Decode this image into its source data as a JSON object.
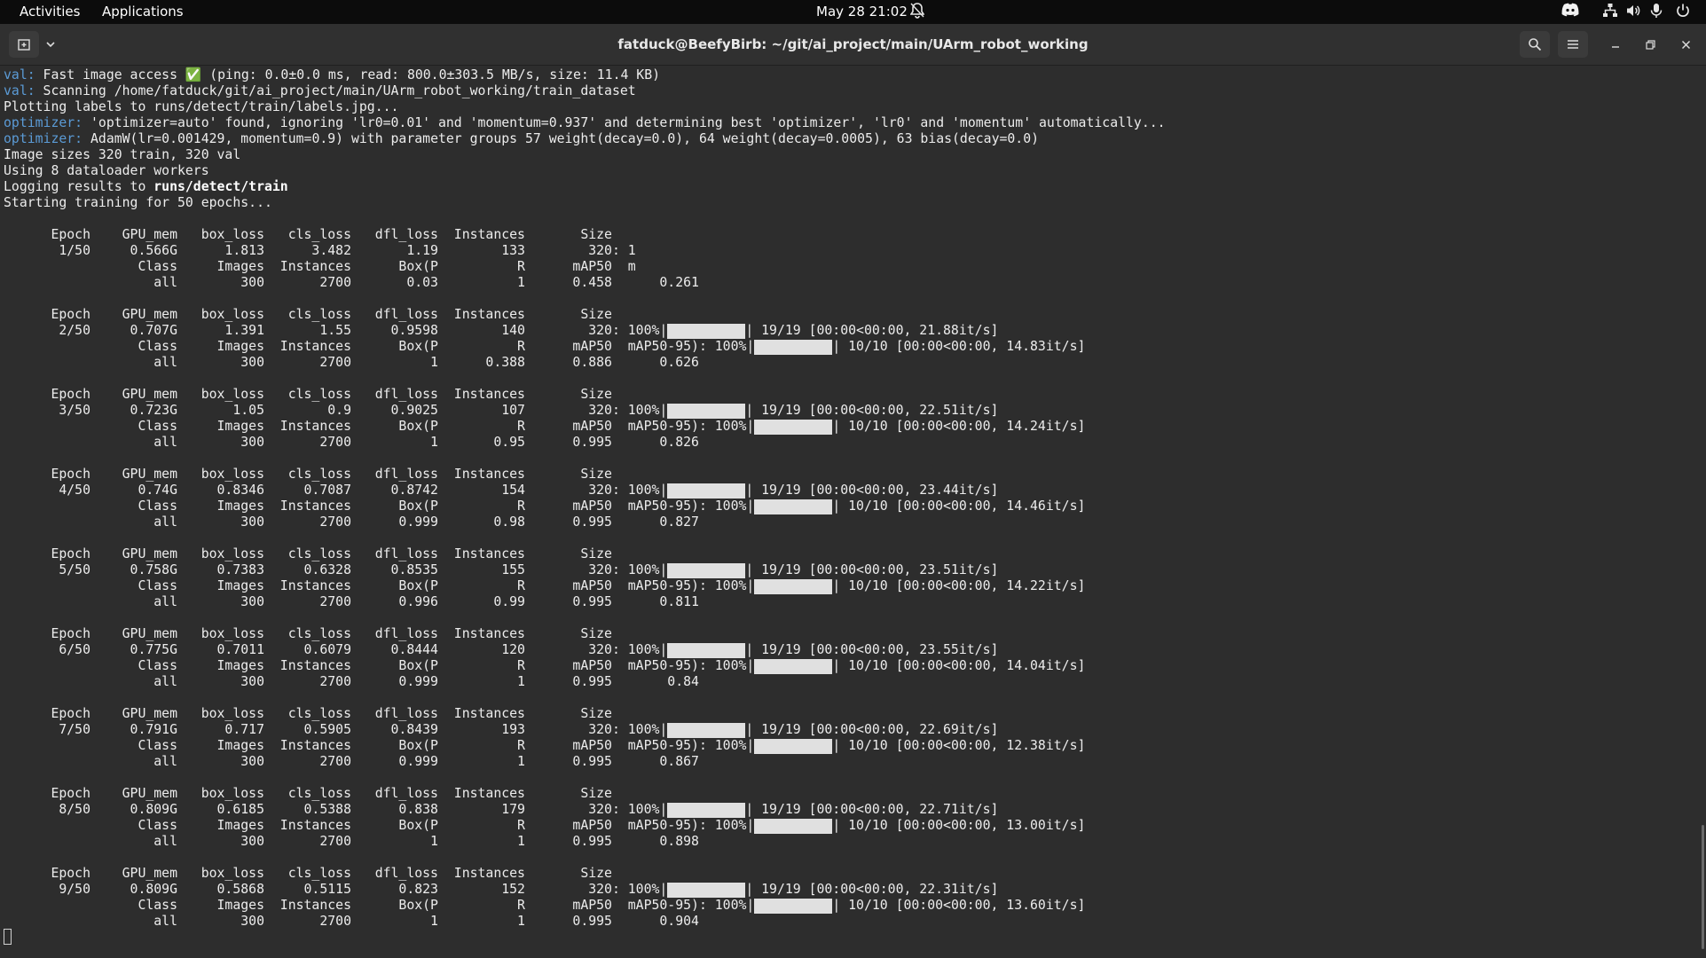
{
  "topbar": {
    "activities": "Activities",
    "applications": "Applications",
    "datetime": "May 28  21:02",
    "icons": [
      "bell-icon",
      "discord-icon",
      "network-icon",
      "volume-icon",
      "mic-icon",
      "power-icon"
    ]
  },
  "window": {
    "title": "fatduck@BeefyBirb: ~/git/ai_project/main/UArm_robot_working",
    "buttons": [
      "new-tab-icon",
      "chevron-down-icon",
      "search-icon",
      "hamburger-menu-icon",
      "minimize-icon",
      "maximize-icon",
      "close-icon"
    ]
  },
  "terminal": {
    "lines": [
      [
        {
          "t": "val:",
          "c": "hl"
        },
        {
          "t": " Fast image access ✅ (ping: 0.0±0.0 ms, read: 800.0±303.5 MB/s, size: 11.4 KB)"
        }
      ],
      [
        {
          "t": "val:",
          "c": "hl"
        },
        {
          "t": " Scanning /home/fatduck/git/ai_project/main/UArm_robot_working/train_dataset"
        }
      ],
      [
        {
          "t": "Plotting labels to runs/detect/train/labels.jpg..."
        }
      ],
      [
        {
          "t": "optimizer:",
          "c": "hl"
        },
        {
          "t": " 'optimizer=auto' found, ignoring 'lr0=0.01' and 'momentum=0.937' and determining best 'optimizer', 'lr0' and 'momentum' automatically..."
        }
      ],
      [
        {
          "t": "optimizer:",
          "c": "hl"
        },
        {
          "t": " AdamW(lr=0.001429, momentum=0.9) with parameter groups 57 weight(decay=0.0), 64 weight(decay=0.0005), 63 bias(decay=0.0)"
        }
      ],
      [
        {
          "t": "Image sizes 320 train, 320 val"
        }
      ],
      [
        {
          "t": "Using 8 dataloader workers"
        }
      ],
      [
        {
          "t": "Logging results to "
        },
        {
          "t": "runs/detect/train",
          "c": "bold"
        }
      ],
      [
        {
          "t": "Starting training for 50 epochs..."
        }
      ],
      [
        {
          "t": ""
        }
      ],
      [
        {
          "t": "      Epoch    GPU_mem   box_loss   cls_loss   dfl_loss  Instances       Size"
        }
      ],
      [
        {
          "t": "       1/50     0.566G      1.813      3.482       1.19        133        320: 1"
        }
      ],
      [
        {
          "t": "                 Class     Images  Instances      Box(P          R      mAP50  m"
        }
      ],
      [
        {
          "t": "                   all        300       2700       0.03          1      0.458      0.261"
        }
      ],
      [
        {
          "t": ""
        }
      ],
      [
        {
          "t": "      Epoch    GPU_mem   box_loss   cls_loss   dfl_loss  Instances       Size"
        }
      ],
      [
        {
          "t": "       2/50     0.707G      1.391       1.55     0.9598        140        320: 100%|"
        },
        {
          "bar": true
        },
        {
          "t": "| 19/19 [00:00<00:00, 21.88it/s]"
        }
      ],
      [
        {
          "t": "                 Class     Images  Instances      Box(P          R      mAP50  mAP50-95): 100%|"
        },
        {
          "bar": true
        },
        {
          "t": "| 10/10 [00:00<00:00, 14.83it/s]"
        }
      ],
      [
        {
          "t": "                   all        300       2700          1      0.388      0.886      0.626"
        }
      ],
      [
        {
          "t": ""
        }
      ],
      [
        {
          "t": "      Epoch    GPU_mem   box_loss   cls_loss   dfl_loss  Instances       Size"
        }
      ],
      [
        {
          "t": "       3/50     0.723G       1.05        0.9     0.9025        107        320: 100%|"
        },
        {
          "bar": true
        },
        {
          "t": "| 19/19 [00:00<00:00, 22.51it/s]"
        }
      ],
      [
        {
          "t": "                 Class     Images  Instances      Box(P          R      mAP50  mAP50-95): 100%|"
        },
        {
          "bar": true
        },
        {
          "t": "| 10/10 [00:00<00:00, 14.24it/s]"
        }
      ],
      [
        {
          "t": "                   all        300       2700          1       0.95      0.995      0.826"
        }
      ],
      [
        {
          "t": ""
        }
      ],
      [
        {
          "t": "      Epoch    GPU_mem   box_loss   cls_loss   dfl_loss  Instances       Size"
        }
      ],
      [
        {
          "t": "       4/50      0.74G     0.8346     0.7087     0.8742        154        320: 100%|"
        },
        {
          "bar": true
        },
        {
          "t": "| 19/19 [00:00<00:00, 23.44it/s]"
        }
      ],
      [
        {
          "t": "                 Class     Images  Instances      Box(P          R      mAP50  mAP50-95): 100%|"
        },
        {
          "bar": true
        },
        {
          "t": "| 10/10 [00:00<00:00, 14.46it/s]"
        }
      ],
      [
        {
          "t": "                   all        300       2700      0.999       0.98      0.995      0.827"
        }
      ],
      [
        {
          "t": ""
        }
      ],
      [
        {
          "t": "      Epoch    GPU_mem   box_loss   cls_loss   dfl_loss  Instances       Size"
        }
      ],
      [
        {
          "t": "       5/50     0.758G     0.7383     0.6328     0.8535        155        320: 100%|"
        },
        {
          "bar": true
        },
        {
          "t": "| 19/19 [00:00<00:00, 23.51it/s]"
        }
      ],
      [
        {
          "t": "                 Class     Images  Instances      Box(P          R      mAP50  mAP50-95): 100%|"
        },
        {
          "bar": true
        },
        {
          "t": "| 10/10 [00:00<00:00, 14.22it/s]"
        }
      ],
      [
        {
          "t": "                   all        300       2700      0.996       0.99      0.995      0.811"
        }
      ],
      [
        {
          "t": ""
        }
      ],
      [
        {
          "t": "      Epoch    GPU_mem   box_loss   cls_loss   dfl_loss  Instances       Size"
        }
      ],
      [
        {
          "t": "       6/50     0.775G     0.7011     0.6079     0.8444        120        320: 100%|"
        },
        {
          "bar": true
        },
        {
          "t": "| 19/19 [00:00<00:00, 23.55it/s]"
        }
      ],
      [
        {
          "t": "                 Class     Images  Instances      Box(P          R      mAP50  mAP50-95): 100%|"
        },
        {
          "bar": true
        },
        {
          "t": "| 10/10 [00:00<00:00, 14.04it/s]"
        }
      ],
      [
        {
          "t": "                   all        300       2700      0.999          1      0.995       0.84"
        }
      ],
      [
        {
          "t": ""
        }
      ],
      [
        {
          "t": "      Epoch    GPU_mem   box_loss   cls_loss   dfl_loss  Instances       Size"
        }
      ],
      [
        {
          "t": "       7/50     0.791G      0.717     0.5905     0.8439        193        320: 100%|"
        },
        {
          "bar": true
        },
        {
          "t": "| 19/19 [00:00<00:00, 22.69it/s]"
        }
      ],
      [
        {
          "t": "                 Class     Images  Instances      Box(P          R      mAP50  mAP50-95): 100%|"
        },
        {
          "bar": true
        },
        {
          "t": "| 10/10 [00:00<00:00, 12.38it/s]"
        }
      ],
      [
        {
          "t": "                   all        300       2700      0.999          1      0.995      0.867"
        }
      ],
      [
        {
          "t": ""
        }
      ],
      [
        {
          "t": "      Epoch    GPU_mem   box_loss   cls_loss   dfl_loss  Instances       Size"
        }
      ],
      [
        {
          "t": "       8/50     0.809G     0.6185     0.5388      0.838        179        320: 100%|"
        },
        {
          "bar": true
        },
        {
          "t": "| 19/19 [00:00<00:00, 22.71it/s]"
        }
      ],
      [
        {
          "t": "                 Class     Images  Instances      Box(P          R      mAP50  mAP50-95): 100%|"
        },
        {
          "bar": true
        },
        {
          "t": "| 10/10 [00:00<00:00, 13.00it/s]"
        }
      ],
      [
        {
          "t": "                   all        300       2700          1          1      0.995      0.898"
        }
      ],
      [
        {
          "t": ""
        }
      ],
      [
        {
          "t": "      Epoch    GPU_mem   box_loss   cls_loss   dfl_loss  Instances       Size"
        }
      ],
      [
        {
          "t": "       9/50     0.809G     0.5868     0.5115      0.823        152        320: 100%|"
        },
        {
          "bar": true
        },
        {
          "t": "| 19/19 [00:00<00:00, 22.31it/s]"
        }
      ],
      [
        {
          "t": "                 Class     Images  Instances      Box(P          R      mAP50  mAP50-95): 100%|"
        },
        {
          "bar": true
        },
        {
          "t": "| 10/10 [00:00<00:00, 13.60it/s]"
        }
      ],
      [
        {
          "t": "                   all        300       2700          1          1      0.995      0.904"
        }
      ]
    ]
  }
}
